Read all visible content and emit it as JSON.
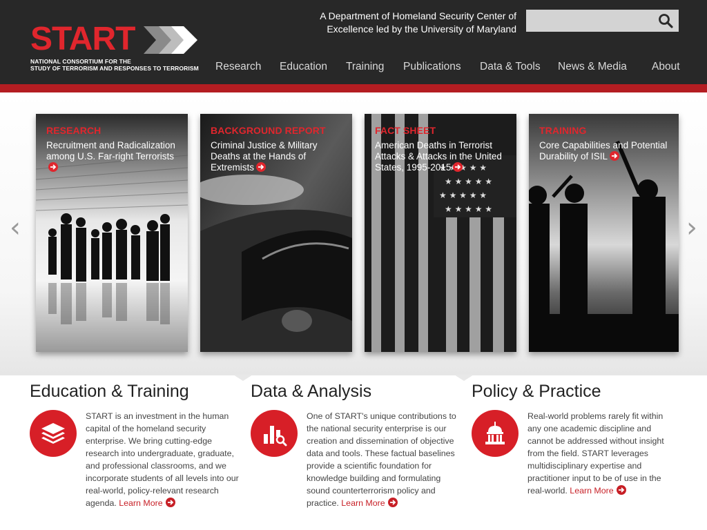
{
  "header": {
    "logo": {
      "word": "START",
      "line1": "NATIONAL CONSORTIUM FOR THE",
      "line2": "STUDY OF TERRORISM AND RESPONSES TO TERRORISM"
    },
    "tagline": "A Department of Homeland Security Center of Excellence led by the University of Maryland",
    "search": {
      "placeholder": "",
      "value": ""
    },
    "nav": [
      "Research",
      "Education",
      "Training",
      "Publications",
      "Data & Tools",
      "News & Media",
      "About"
    ]
  },
  "colors": {
    "accent": "#e0262d",
    "header_bg": "#282828",
    "red_bar": "#b41d22"
  },
  "carousel": {
    "prev_icon": "‹",
    "next_icon": "›",
    "cards": [
      {
        "category": "RESEARCH",
        "title": "Recruitment and Radicalization among U.S. Far-right Terrorists"
      },
      {
        "category": "BACKGROUND REPORT",
        "title": "Criminal Justice & Military Deaths at the Hands of Extremists"
      },
      {
        "category": "FACT SHEET",
        "title": "American Deaths in Terrorist Attacks & Attacks in the United States, 1995-2015"
      },
      {
        "category": "TRAINING",
        "title": "Core Capabilities and Potential Durability of ISIL"
      }
    ]
  },
  "features": [
    {
      "title": "Education & Training",
      "icon": "layers-icon",
      "text": "START is an investment in the human capital of the homeland security enterprise. We bring cutting-edge research into undergraduate, graduate, and professional classrooms, and we incorporate students of all levels into our real-world, policy-relevant research agenda.",
      "link": "Learn More"
    },
    {
      "title": "Data & Analysis",
      "icon": "bar-chart-search-icon",
      "text": "One of START's unique contributions to the national security enterprise is our creation and dissemination of objective data and tools. These factual baselines provide a scientific foundation for knowledge building and formulating sound counterterrorism policy and practice.",
      "link": "Learn More"
    },
    {
      "title": "Policy & Practice",
      "icon": "capitol-building-icon",
      "text": "Real-world problems rarely fit within any one academic discipline and cannot be addressed without insight from the field.  START leverages multidisciplinary expertise and practitioner input to be of use in the real-world.",
      "link": "Learn More"
    }
  ]
}
